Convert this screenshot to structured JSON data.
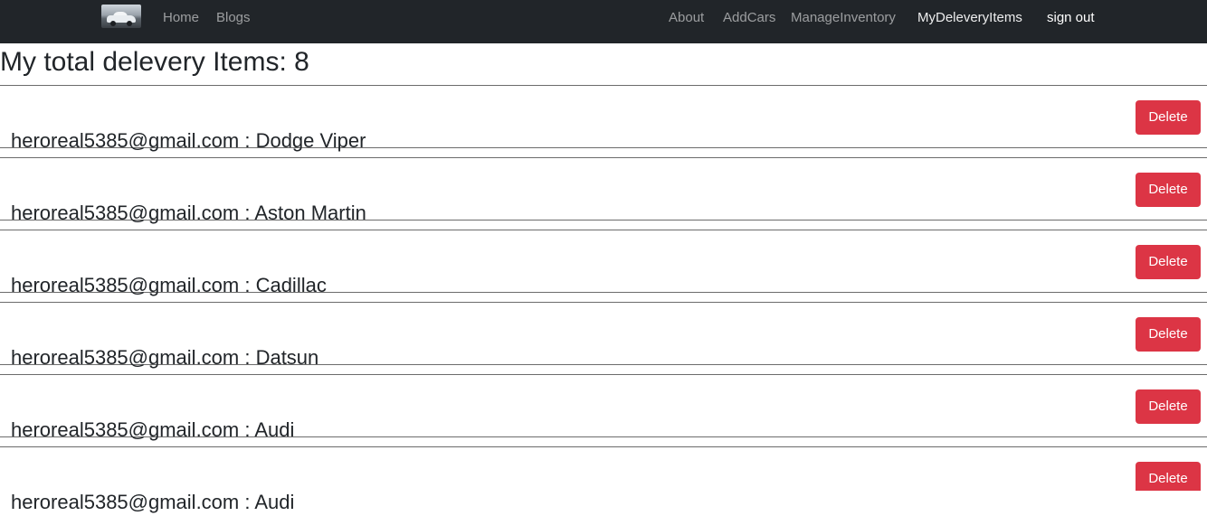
{
  "navbar": {
    "logo_icon": "car-logo-icon",
    "left_links": [
      "Home",
      "Blogs"
    ],
    "right_links": [
      "About",
      "AddCars",
      "ManageInventory",
      "MyDeleveryItems"
    ],
    "signout_label": "sign out",
    "background": "#212529"
  },
  "page": {
    "title": "My total delevery Items: 8"
  },
  "items": [
    {
      "text": "heroreal5385@gmail.com : Dodge Viper",
      "delete_label": "Delete"
    },
    {
      "text": "heroreal5385@gmail.com : Aston Martin",
      "delete_label": "Delete"
    },
    {
      "text": "heroreal5385@gmail.com : Cadillac",
      "delete_label": "Delete"
    },
    {
      "text": "heroreal5385@gmail.com : Datsun",
      "delete_label": "Delete"
    },
    {
      "text": "heroreal5385@gmail.com : Audi",
      "delete_label": "Delete"
    },
    {
      "text": "heroreal5385@gmail.com : Audi",
      "delete_label": "Delete"
    }
  ],
  "colors": {
    "danger": "#dc3545",
    "text": "#212529"
  }
}
